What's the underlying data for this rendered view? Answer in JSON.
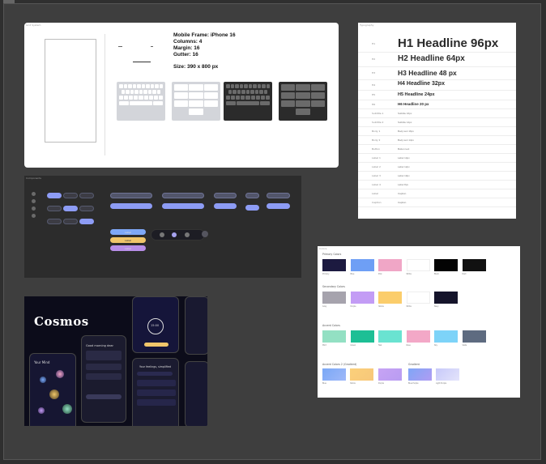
{
  "canvas": {
    "page_tag": ""
  },
  "grid": {
    "label": "Grid System",
    "spec_lines": [
      "Mobile Frame: iPhone 16",
      "Columns: 4",
      "Margin: 16",
      "Gutter: 16"
    ],
    "size": "Size: 390 x 800 px",
    "keyboards": [
      "light-qwerty",
      "light-numpad",
      "dark-qwerty",
      "dark-numpad"
    ]
  },
  "typography": {
    "label": "Typography",
    "rows": [
      {
        "tag": "H1",
        "text": "H1 Headline 96px"
      },
      {
        "tag": "H2",
        "text": "H2 Headline 64px"
      },
      {
        "tag": "H3",
        "text": "H3 Headline 48 px"
      },
      {
        "tag": "H4",
        "text": "H4 Headline 32px"
      },
      {
        "tag": "H5",
        "text": "H5 Headline 24px"
      },
      {
        "tag": "H6",
        "text": "H6 Headline 20 px"
      },
      {
        "tag": "Subtitle 1",
        "text": "Subtitle 16px"
      },
      {
        "tag": "Subtitle 2",
        "text": "Subtitle 14px"
      },
      {
        "tag": "Body 1",
        "text": "Body text 16px"
      },
      {
        "tag": "Body 2",
        "text": "Body text 14px"
      },
      {
        "tag": "Button",
        "text": "Button text"
      },
      {
        "tag": "Label 1",
        "text": "Label 14px"
      },
      {
        "tag": "Label 2",
        "text": "Label 12px"
      },
      {
        "tag": "Label 3",
        "text": "Label 10px"
      },
      {
        "tag": "Label 4",
        "text": "Label 8px"
      },
      {
        "tag": "Label",
        "text": "Caption"
      },
      {
        "tag": "Caption",
        "text": "Caption"
      }
    ]
  },
  "components": {
    "label": "Components",
    "buttons": [
      "Label",
      "Label",
      "Label",
      "Label",
      "Label",
      "Label"
    ],
    "stacked": [
      "Label",
      "Label",
      "Label"
    ]
  },
  "cosmos": {
    "label": "Cosmos",
    "logo": "Cosmos",
    "screens": {
      "mind_title": "Your Mind",
      "chat_title": "Good morning dear",
      "timer": "15:00",
      "feeling_title": "Your feelings, simplified"
    }
  },
  "colors": {
    "label": "Colors",
    "sections": [
      {
        "title": "Primary Colors",
        "swatches": [
          {
            "name": "Primary",
            "hex": "#1c1a40"
          },
          {
            "name": "Blue",
            "hex": "#6e9ff5"
          },
          {
            "name": "Pink",
            "hex": "#f0a6c6"
          },
          {
            "name": "White",
            "hex": "#ffffff"
          },
          {
            "name": "Black",
            "hex": "#030303"
          },
          {
            "name": "Dark",
            "hex": "#111111"
          }
        ]
      },
      {
        "title": "Secondary Colors",
        "swatches": [
          {
            "name": "Grey",
            "hex": "#a6a3ad"
          },
          {
            "name": "Purple",
            "hex": "#c39cf5"
          },
          {
            "name": "Yellow",
            "hex": "#fbcd6b"
          },
          {
            "name": "White",
            "hex": "#ffffff"
          },
          {
            "name": "Navy",
            "hex": "#15142b"
          }
        ]
      },
      {
        "title": "Accent Colors",
        "swatches": [
          {
            "name": "Mint",
            "hex": "#93e0c3"
          },
          {
            "name": "Green",
            "hex": "#1dbf95"
          },
          {
            "name": "Teal",
            "hex": "#6ae3d1"
          },
          {
            "name": "Rose",
            "hex": "#f3a8c7"
          },
          {
            "name": "Sky",
            "hex": "#7dd3f8"
          },
          {
            "name": "Slate",
            "hex": "#5e6b80"
          }
        ]
      }
    ],
    "gradient_section_title": "Accent Colors 2 (Gradient)",
    "gradient_title": "Gradient",
    "gradients": [
      {
        "name": "Blue",
        "from": "#7aa8f6",
        "to": "#9fb8f8"
      },
      {
        "name": "Yellow",
        "from": "#fbd07a",
        "to": "#f7c77a"
      },
      {
        "name": "Purple",
        "from": "#c7a3f4",
        "to": "#b89cf2"
      },
      {
        "name": "Blue Purple",
        "from": "#7fa6f6",
        "to": "#b09cf3"
      },
      {
        "name": "Light Purple",
        "from": "#c7c9f9",
        "to": "#e4e4fb"
      }
    ]
  }
}
